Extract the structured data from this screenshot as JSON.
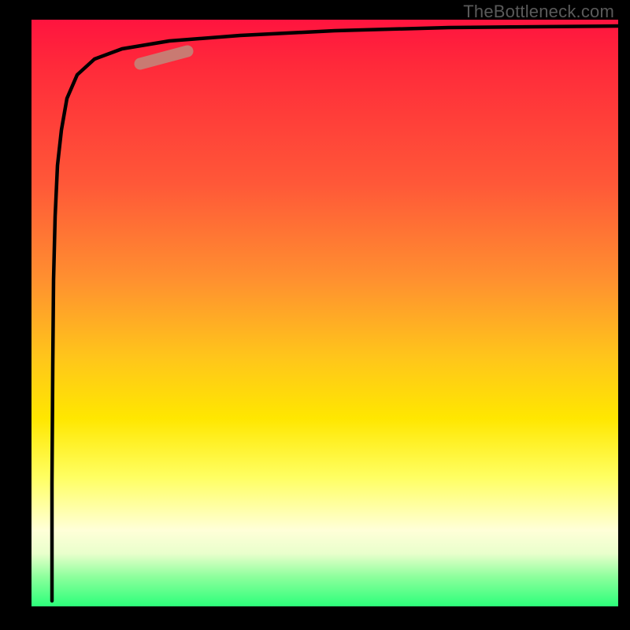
{
  "watermark": "TheBottleneck.com",
  "chart_data": {
    "type": "line",
    "title": "",
    "xlabel": "",
    "ylabel": "",
    "xlim": [
      0,
      100
    ],
    "ylim": [
      0,
      100
    ],
    "series": [
      {
        "name": "curve",
        "x": [
          3.5,
          3.6,
          3.8,
          4.0,
          4.3,
          4.7,
          5.3,
          6.2,
          8.0,
          11.0,
          16.0,
          24.0,
          36.0,
          52.0,
          72.0,
          100.0
        ],
        "values": [
          1.0,
          20.0,
          40.0,
          55.0,
          66.0,
          75.0,
          82.0,
          87.0,
          91.0,
          93.5,
          95.3,
          96.6,
          97.5,
          98.2,
          98.7,
          99.0
        ]
      }
    ],
    "marker": {
      "x_center": 22.5,
      "y_center": 93.9,
      "len_pct": 8.0
    },
    "gradient_stops": [
      {
        "pct": 0,
        "color": "#ff143f"
      },
      {
        "pct": 28,
        "color": "#ff5838"
      },
      {
        "pct": 58,
        "color": "#ffc71a"
      },
      {
        "pct": 78,
        "color": "#ffff62"
      },
      {
        "pct": 95,
        "color": "#8cff9c"
      },
      {
        "pct": 100,
        "color": "#2cff7a"
      }
    ]
  }
}
